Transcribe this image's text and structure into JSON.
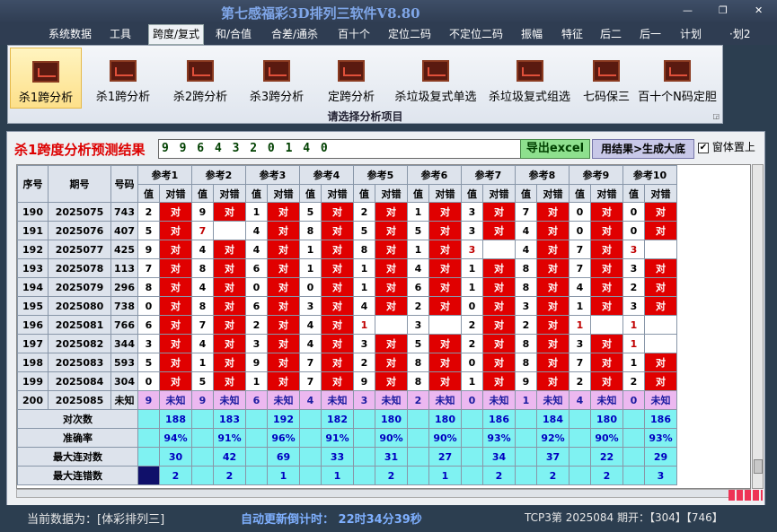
{
  "app": {
    "title": "第七感福彩3D排列三软件V8.80"
  },
  "menu": [
    "系统数据",
    "工具",
    "跨度/复式",
    "和/合值",
    "合差/通杀",
    "百十个",
    "定位二码",
    "不定位二码",
    "振幅",
    "特征",
    "后二",
    "后一",
    "计划",
    "·划2"
  ],
  "ribbon": {
    "buttons": [
      "杀1跨分析",
      "杀1跨分析",
      "杀2跨分析",
      "杀3跨分析",
      "定跨分析",
      "杀垃圾复式单选",
      "杀垃圾复式组选",
      "七码保三",
      "百十个N码定胆"
    ],
    "caption": "请选择分析项目"
  },
  "result": {
    "title": "杀1跨度分析预测结果",
    "value": "9 9 6 4 3 2 0 1 4 0",
    "export_label": "导出excel",
    "generate_label": "用结果>生成大底",
    "ontop_label": "窗体置上"
  },
  "table": {
    "col_seq": "序号",
    "col_period": "期号",
    "col_number": "号码",
    "ref_labels": [
      "参考1",
      "参考2",
      "参考3",
      "参考4",
      "参考5",
      "参考6",
      "参考7",
      "参考8",
      "参考9",
      "参考10"
    ],
    "sub_val": "值",
    "sub_hit": "对错",
    "hit_text": "对",
    "unknown_text": "未知",
    "rows": [
      {
        "seq": "190",
        "period": "2025075",
        "num": "743",
        "refs": [
          [
            "2",
            1
          ],
          [
            "9",
            1
          ],
          [
            "1",
            1
          ],
          [
            "5",
            1
          ],
          [
            "2",
            1
          ],
          [
            "1",
            1
          ],
          [
            "3",
            1
          ],
          [
            "7",
            1
          ],
          [
            "0",
            1
          ],
          [
            "0",
            1
          ]
        ]
      },
      {
        "seq": "191",
        "period": "2025076",
        "num": "407",
        "refs": [
          [
            "5",
            1
          ],
          [
            "7",
            0,
            1
          ],
          [
            "4",
            1
          ],
          [
            "8",
            1
          ],
          [
            "5",
            1
          ],
          [
            "5",
            1
          ],
          [
            "3",
            1
          ],
          [
            "4",
            1
          ],
          [
            "0",
            1
          ],
          [
            "0",
            1
          ]
        ]
      },
      {
        "seq": "192",
        "period": "2025077",
        "num": "425",
        "refs": [
          [
            "9",
            1
          ],
          [
            "4",
            1
          ],
          [
            "4",
            1
          ],
          [
            "1",
            1
          ],
          [
            "8",
            1
          ],
          [
            "1",
            1
          ],
          [
            "3",
            0,
            1
          ],
          [
            "4",
            1
          ],
          [
            "7",
            1
          ],
          [
            "3",
            0,
            1
          ]
        ]
      },
      {
        "seq": "193",
        "period": "2025078",
        "num": "113",
        "refs": [
          [
            "7",
            1
          ],
          [
            "8",
            1
          ],
          [
            "6",
            1
          ],
          [
            "1",
            1
          ],
          [
            "1",
            1
          ],
          [
            "4",
            1
          ],
          [
            "1",
            1
          ],
          [
            "8",
            1
          ],
          [
            "7",
            1
          ],
          [
            "3",
            1
          ]
        ]
      },
      {
        "seq": "194",
        "period": "2025079",
        "num": "296",
        "refs": [
          [
            "8",
            1
          ],
          [
            "4",
            1
          ],
          [
            "0",
            1
          ],
          [
            "0",
            1
          ],
          [
            "1",
            1
          ],
          [
            "6",
            1
          ],
          [
            "1",
            1
          ],
          [
            "8",
            1
          ],
          [
            "4",
            1
          ],
          [
            "2",
            1
          ]
        ]
      },
      {
        "seq": "195",
        "period": "2025080",
        "num": "738",
        "refs": [
          [
            "0",
            1
          ],
          [
            "8",
            1
          ],
          [
            "6",
            1
          ],
          [
            "3",
            1
          ],
          [
            "4",
            1
          ],
          [
            "2",
            1
          ],
          [
            "0",
            1
          ],
          [
            "3",
            1
          ],
          [
            "1",
            1
          ],
          [
            "3",
            1
          ]
        ]
      },
      {
        "seq": "196",
        "period": "2025081",
        "num": "766",
        "refs": [
          [
            "6",
            1
          ],
          [
            "7",
            1
          ],
          [
            "2",
            1
          ],
          [
            "4",
            1
          ],
          [
            "1",
            0,
            1
          ],
          [
            "3",
            0
          ],
          [
            "2",
            1
          ],
          [
            "2",
            1
          ],
          [
            "1",
            0,
            1
          ],
          [
            "1",
            0,
            1
          ]
        ]
      },
      {
        "seq": "197",
        "period": "2025082",
        "num": "344",
        "refs": [
          [
            "3",
            1
          ],
          [
            "4",
            1
          ],
          [
            "3",
            1
          ],
          [
            "4",
            1
          ],
          [
            "3",
            1
          ],
          [
            "5",
            1
          ],
          [
            "2",
            1
          ],
          [
            "8",
            1
          ],
          [
            "3",
            1
          ],
          [
            "1",
            0,
            1
          ]
        ]
      },
      {
        "seq": "198",
        "period": "2025083",
        "num": "593",
        "refs": [
          [
            "5",
            1
          ],
          [
            "1",
            1
          ],
          [
            "9",
            1
          ],
          [
            "7",
            1
          ],
          [
            "2",
            1
          ],
          [
            "8",
            1
          ],
          [
            "0",
            1
          ],
          [
            "8",
            1
          ],
          [
            "7",
            1
          ],
          [
            "1",
            1
          ]
        ]
      },
      {
        "seq": "199",
        "period": "2025084",
        "num": "304",
        "refs": [
          [
            "0",
            1
          ],
          [
            "5",
            1
          ],
          [
            "1",
            1
          ],
          [
            "7",
            1
          ],
          [
            "9",
            1
          ],
          [
            "8",
            1
          ],
          [
            "1",
            1
          ],
          [
            "9",
            1
          ],
          [
            "2",
            1
          ],
          [
            "2",
            1
          ]
        ]
      }
    ],
    "pending": {
      "seq": "200",
      "period": "2025085",
      "num": "未知",
      "vals": [
        "9",
        "9",
        "6",
        "4",
        "3",
        "2",
        "0",
        "1",
        "4",
        "0"
      ]
    },
    "stats": [
      {
        "label": "对次数",
        "vals": [
          "188",
          "183",
          "192",
          "182",
          "180",
          "180",
          "186",
          "184",
          "180",
          "186"
        ]
      },
      {
        "label": "准确率",
        "vals": [
          "94%",
          "91%",
          "96%",
          "91%",
          "90%",
          "90%",
          "93%",
          "92%",
          "90%",
          "93%"
        ]
      },
      {
        "label": "最大连对数",
        "vals": [
          "30",
          "42",
          "69",
          "33",
          "31",
          "27",
          "34",
          "37",
          "22",
          "29"
        ]
      },
      {
        "label": "最大连错数",
        "vals": [
          "2",
          "2",
          "1",
          "1",
          "2",
          "1",
          "2",
          "2",
          "2",
          "3"
        ]
      }
    ]
  },
  "status": {
    "left": "当前数据为：[体彩排列三]",
    "mid": "自动更新倒计时： 22时34分39秒",
    "right": "TCP3第 2025084 期开：【304】【746】"
  }
}
